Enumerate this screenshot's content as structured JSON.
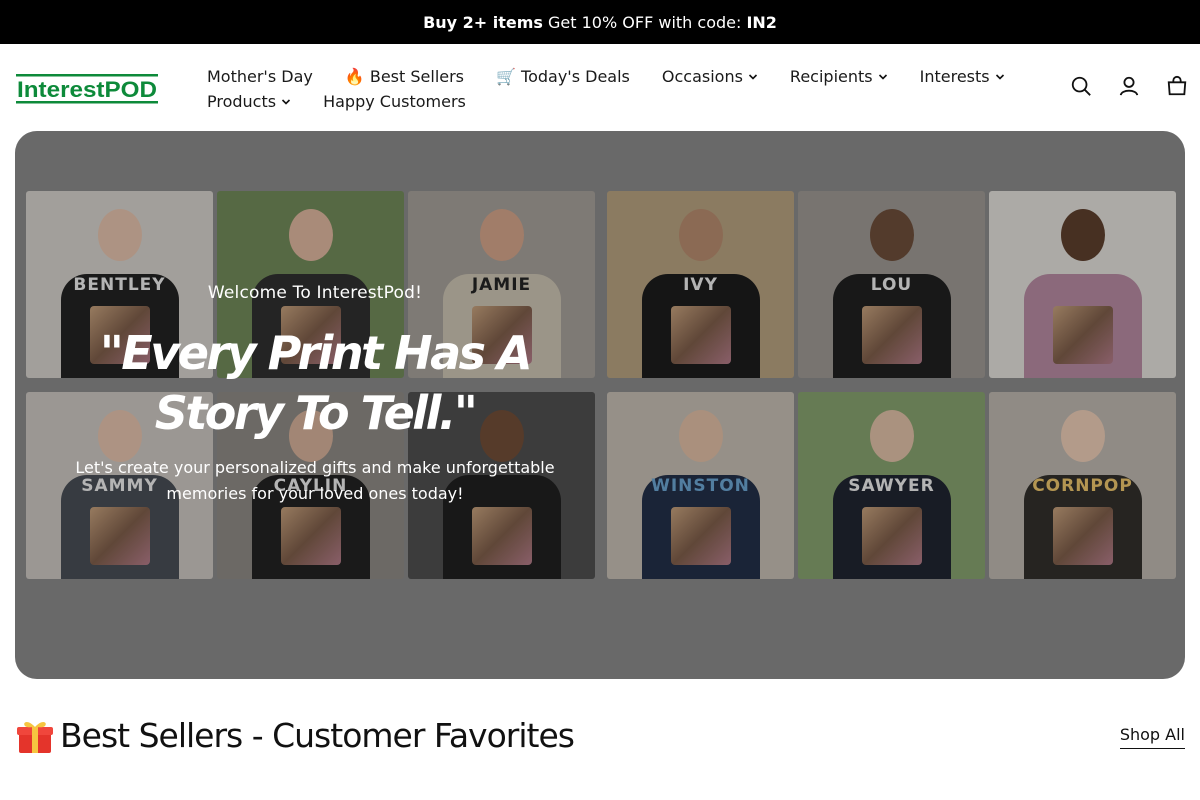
{
  "announcement": {
    "bold": "Buy 2+ items",
    "text": " Get 10% OFF with code: ",
    "code": "IN2"
  },
  "header": {
    "logo_text": "InterestPOD",
    "nav_row1": [
      {
        "label": "Mother's Day",
        "has_dropdown": false
      },
      {
        "label": "🔥 Best Sellers",
        "has_dropdown": false
      },
      {
        "label": "🛒 Today's Deals",
        "has_dropdown": false
      },
      {
        "label": "Occasions",
        "has_dropdown": true
      },
      {
        "label": "Recipients",
        "has_dropdown": true
      },
      {
        "label": "Interests",
        "has_dropdown": true
      }
    ],
    "nav_row2": [
      {
        "label": "Products",
        "has_dropdown": true
      },
      {
        "label": "Happy Customers",
        "has_dropdown": false
      }
    ],
    "icons": [
      "search-icon",
      "account-icon",
      "cart-icon"
    ]
  },
  "hero": {
    "eyebrow": "Welcome To InterestPod!",
    "headline": "\"Every Print Has A Story To Tell.\"",
    "subcopy": "Let's create your personalized gifts and make unforgettable memories for your loved ones today!",
    "photo_words": [
      "BENTLEY",
      "",
      "JAMIE",
      "IVY",
      "LOU",
      "",
      "SAMMY",
      "CAYLIN",
      "",
      "WINSTON",
      "SAWYER",
      "CORNPOP"
    ]
  },
  "best_sellers": {
    "title": "Best Sellers - Customer Favorites",
    "emoji_icon": "gift-icon",
    "link": "Shop All"
  },
  "colors": {
    "announce_bg": "#000000",
    "logo_green": "#0d8a3a",
    "hero_overlay": "#8a8a8a"
  }
}
